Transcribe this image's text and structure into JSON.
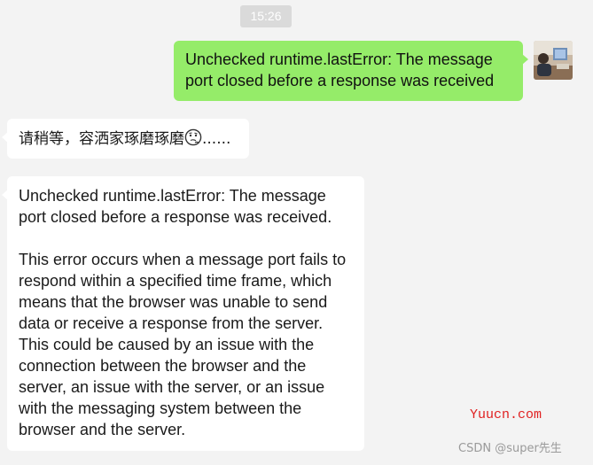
{
  "chat": {
    "timestamp": "15:26",
    "messages": [
      {
        "side": "outgoing",
        "text": "Unchecked runtime.lastError: The message port closed before a response was received"
      },
      {
        "side": "incoming",
        "text": "请稍等，容洒家琢磨琢磨",
        "emoji_icon": "thinking-face-icon",
        "suffix": "......"
      },
      {
        "side": "incoming",
        "paragraphs": [
          "Unchecked runtime.lastError: The message port closed before a response was received.",
          "This error occurs when a message port fails to respond within a specified time frame, which means that the browser was unable to send data or receive a response from the server. This could be caused by an issue with the connection between the browser and the server, an issue with the server, or an issue with the messaging system between the browser and the server."
        ]
      }
    ]
  },
  "watermarks": {
    "yuucn": "Yuucn.com",
    "csdn": "CSDN @super先生"
  },
  "colors": {
    "background": "#f3f3f3",
    "outgoing_bubble": "#95ec69",
    "incoming_bubble": "#ffffff",
    "timestamp_badge": "#dadada",
    "watermark_red": "#e02020"
  }
}
